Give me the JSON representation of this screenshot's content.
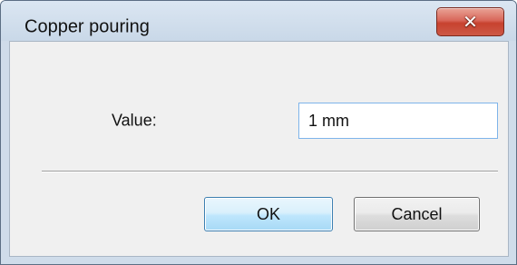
{
  "window": {
    "title": "Copper pouring",
    "close_icon": "close-x-icon",
    "close_glyph": "✕"
  },
  "form": {
    "value_label": "Value:",
    "value_input": "1 mm"
  },
  "buttons": {
    "ok_label": "OK",
    "cancel_label": "Cancel"
  },
  "colors": {
    "titlebar": "#cfdcea",
    "close_button": "#c7422f",
    "client_background": "#f0f0f0",
    "input_focus_border": "#7eb4ea",
    "default_button_border": "#3c7fb1"
  }
}
